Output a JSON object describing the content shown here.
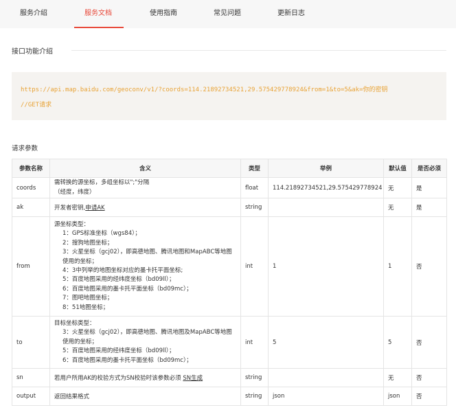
{
  "tabs": [
    "服务介绍",
    "服务文档",
    "使用指南",
    "常见问题",
    "更新日志"
  ],
  "section_title": "接口功能介绍",
  "code": {
    "url": "https://api.map.baidu.com/geoconv/v1/?coords=114.21892734521,29.575429778924&from=1&to=5&ak=你的密钥",
    "comment": "//GET请求"
  },
  "params_label": "请求参数",
  "table": {
    "headers": [
      "参数名称",
      "含义",
      "类型",
      "举例",
      "默认值",
      "是否必须"
    ],
    "rows": [
      {
        "name": "coords",
        "desc": [
          "需转换的源坐标，多组坐标以\";\"分隔",
          "（经度，纬度）"
        ],
        "type": "float",
        "example": "114.21892734521,29.575429778924",
        "default": "无",
        "required": "是"
      },
      {
        "name": "ak",
        "desc_prefix": "开发者密钥,",
        "desc_link": "申请AK",
        "type": "string",
        "example": "",
        "default": "无",
        "required": "是"
      },
      {
        "name": "from",
        "desc": [
          "源坐标类型：",
          "1：GPS标准坐标（wgs84）；",
          "2：搜狗地图坐标；",
          "3：火星坐标（gcj02），即高德地图、腾讯地图和MapABC等地图使用的坐标；",
          "4：3中列举的地图坐标对应的墨卡托平面坐标;",
          "5：百度地图采用的经纬度坐标（bd09ll）；",
          "6：百度地图采用的墨卡托平面坐标（bd09mc）；",
          "7：图吧地图坐标；",
          "8：51地图坐标；"
        ],
        "type": "int",
        "example": "1",
        "default": "1",
        "required": "否"
      },
      {
        "name": "to",
        "desc": [
          "目标坐标类型：",
          "3：火星坐标（gcj02），即高德地图、腾讯地图及MapABC等地图使用的坐标；",
          "5：百度地图采用的经纬度坐标（bd09ll）；",
          "6：百度地图采用的墨卡托平面坐标（bd09mc）；"
        ],
        "type": "int",
        "example": "5",
        "default": "5",
        "required": "否"
      },
      {
        "name": "sn",
        "desc_prefix": "若用户所用AK的校验方式为SN校验时该参数必须 ",
        "desc_link": "SN生成",
        "type": "string",
        "example": "",
        "default": "无",
        "required": "否"
      },
      {
        "name": "output",
        "desc": [
          "返回结果格式"
        ],
        "type": "string",
        "example": "json",
        "default": "json",
        "required": "否"
      }
    ]
  }
}
